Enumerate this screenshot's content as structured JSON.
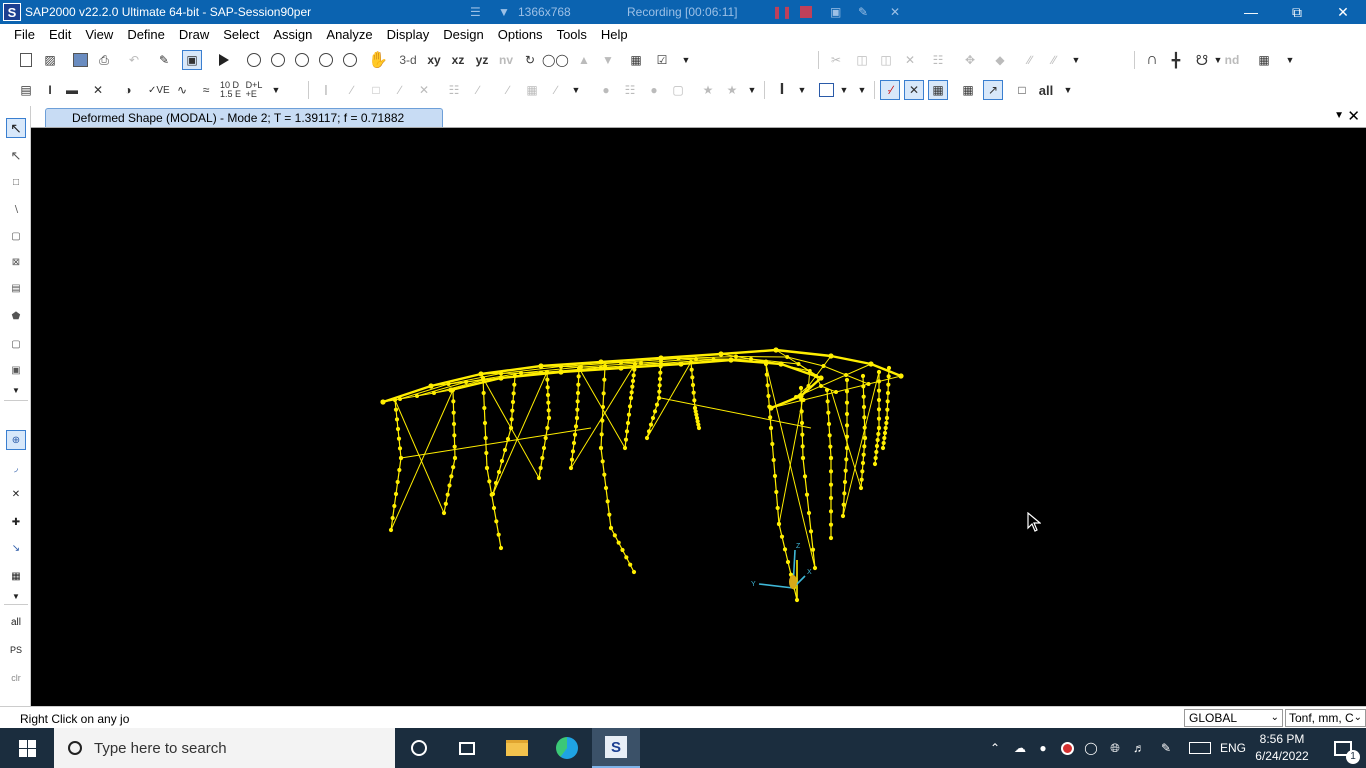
{
  "window": {
    "title": "SAP2000 v22.2.0 Ultimate 64-bit - SAP-Session90per",
    "logo_letter": "S"
  },
  "recorder": {
    "resolution": "1366x768",
    "status": "Recording [00:06:11]"
  },
  "menu": [
    "File",
    "Edit",
    "View",
    "Define",
    "Draw",
    "Select",
    "Assign",
    "Analyze",
    "Display",
    "Design",
    "Options",
    "Tools",
    "Help"
  ],
  "toolbar": {
    "view_3d": "3-d",
    "view_xy": "xy",
    "view_xz": "xz",
    "view_yz": "yz",
    "view_nv": "nv",
    "nd": "nd",
    "all": "all"
  },
  "left_toolbar": {
    "all": "all",
    "ps": "PS",
    "clr": "clr"
  },
  "document_tab": {
    "title": "Deformed Shape (MODAL) - Mode 2; T = 1.39117;  f = 0.71882"
  },
  "axes": {
    "x": "X",
    "y": "Y",
    "z": "Z"
  },
  "status": {
    "text": "Right Click on any jo",
    "coordinate_system": "GLOBAL",
    "units": "Tonf, mm, C"
  },
  "taskbar": {
    "search_placeholder": "Type here to search",
    "language": "ENG",
    "time": "8:56 PM",
    "date": "6/24/2022",
    "notification_count": "1"
  },
  "colors": {
    "titlebar": "#0b63b0",
    "model": "#ffee00",
    "viewport_bg": "#000000",
    "taskbar": "#1b2d3e"
  }
}
